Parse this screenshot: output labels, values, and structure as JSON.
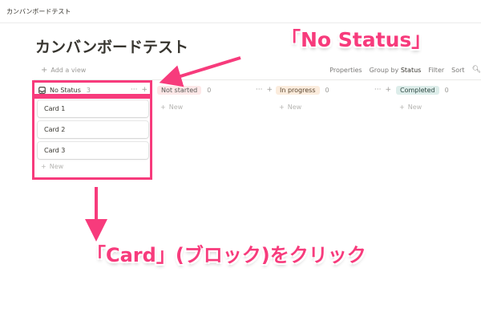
{
  "window": {
    "breadcrumb": "カンバンボードテスト"
  },
  "page": {
    "title": "カンバンボードテスト"
  },
  "view_bar": {
    "add_view": "Add a view",
    "properties": "Properties",
    "group_by_prefix": "Group by",
    "group_by_value": "Status",
    "filter": "Filter",
    "sort": "Sort"
  },
  "board": {
    "columns": [
      {
        "label": "No Status",
        "count": "3",
        "new": "New",
        "cards": [
          {
            "label": "Card 1"
          },
          {
            "label": "Card 2"
          },
          {
            "label": "Card 3"
          }
        ]
      },
      {
        "label": "Not started",
        "count": "0",
        "new": "New",
        "color": "#fde8e8"
      },
      {
        "label": "In progress",
        "count": "0",
        "new": "New",
        "color": "#fbecdd"
      },
      {
        "label": "Completed",
        "count": "0",
        "new": "New",
        "color": "#ddedea"
      }
    ]
  },
  "annotations": {
    "callout_top": "「No Status」",
    "callout_bottom": "「Card」(ブロック)をクリック",
    "accent": "#f73b7c"
  },
  "icons": [
    "inbox-icon",
    "more-icon",
    "plus-icon",
    "search-icon",
    "arrow-icon"
  ]
}
